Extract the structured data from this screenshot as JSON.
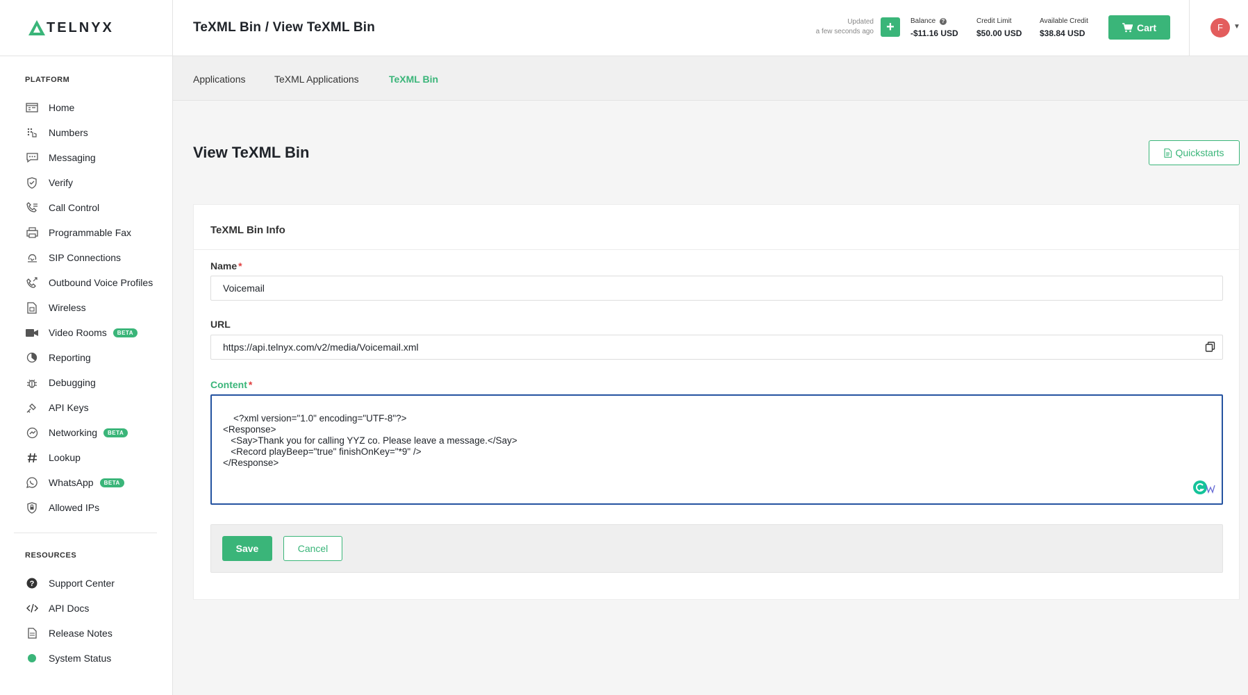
{
  "brand": {
    "logo_text": "TELNYX",
    "accent": "#3ab579"
  },
  "header": {
    "breadcrumb": "TeXML Bin / View TeXML Bin",
    "updated_label": "Updated",
    "updated_time": "a few seconds ago",
    "balance_label": "Balance",
    "balance_value": "-$11.16 USD",
    "credit_limit_label": "Credit Limit",
    "credit_limit_value": "$50.00 USD",
    "available_credit_label": "Available Credit",
    "available_credit_value": "$38.84 USD",
    "cart_label": "Cart",
    "avatar_initial": "F"
  },
  "sidebar": {
    "platform_title": "PLATFORM",
    "items": [
      {
        "label": "Home",
        "icon": "home-icon"
      },
      {
        "label": "Numbers",
        "icon": "numbers-icon"
      },
      {
        "label": "Messaging",
        "icon": "message-icon"
      },
      {
        "label": "Verify",
        "icon": "shield-check-icon"
      },
      {
        "label": "Call Control",
        "icon": "phone-icon"
      },
      {
        "label": "Programmable Fax",
        "icon": "fax-icon"
      },
      {
        "label": "SIP Connections",
        "icon": "sip-icon"
      },
      {
        "label": "Outbound Voice Profiles",
        "icon": "outbound-phone-icon"
      },
      {
        "label": "Wireless",
        "icon": "sim-card-icon"
      },
      {
        "label": "Video Rooms",
        "icon": "video-camera-icon",
        "badge": "BETA"
      },
      {
        "label": "Reporting",
        "icon": "pie-chart-icon"
      },
      {
        "label": "Debugging",
        "icon": "bug-icon"
      },
      {
        "label": "API Keys",
        "icon": "key-icon"
      },
      {
        "label": "Networking",
        "icon": "network-icon",
        "badge": "BETA"
      },
      {
        "label": "Lookup",
        "icon": "hash-icon"
      },
      {
        "label": "WhatsApp",
        "icon": "whatsapp-icon",
        "badge": "BETA"
      },
      {
        "label": "Allowed IPs",
        "icon": "shield-icon"
      }
    ],
    "resources_title": "RESOURCES",
    "resources": [
      {
        "label": "Support Center",
        "icon": "help-icon"
      },
      {
        "label": "API Docs",
        "icon": "code-icon"
      },
      {
        "label": "Release Notes",
        "icon": "document-icon"
      },
      {
        "label": "System Status",
        "icon": "status-dot-icon"
      }
    ]
  },
  "tabs": [
    {
      "label": "Applications"
    },
    {
      "label": "TeXML Applications"
    },
    {
      "label": "TeXML Bin",
      "active": true
    }
  ],
  "page": {
    "title": "View TeXML Bin",
    "quickstarts_label": "Quickstarts"
  },
  "card": {
    "title": "TeXML Bin Info",
    "name_label": "Name",
    "name_required": "*",
    "name_value": "Voicemail",
    "url_label": "URL",
    "url_value": "https://api.telnyx.com/v2/media/Voicemail.xml",
    "content_label": "Content",
    "content_required": "*",
    "content_value": "<?xml version=\"1.0\" encoding=\"UTF-8\"?>\n<Response>\n   <Say>Thank you for calling YYZ co. Please leave a message.</Say>\n   <Record playBeep=\"true\" finishOnKey=\"*9\" />\n</Response>",
    "save_label": "Save",
    "cancel_label": "Cancel"
  }
}
